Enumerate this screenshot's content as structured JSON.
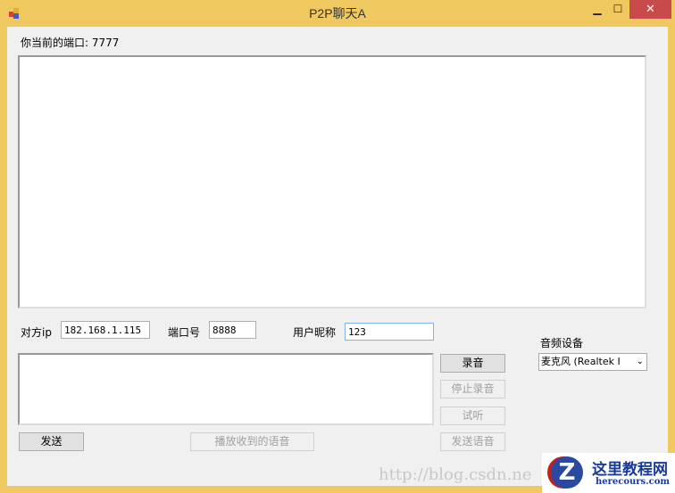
{
  "window": {
    "title": "P2P聊天A",
    "minimize": "▁",
    "maximize": "☐",
    "close": "✕"
  },
  "port_label": "你当前的端口: 7777",
  "chat_log": "",
  "peer_ip": {
    "label": "对方ip",
    "value": "182.168.1.115"
  },
  "peer_port": {
    "label": "端口号",
    "value": "8888"
  },
  "nickname": {
    "label": "用户昵称",
    "value": "123"
  },
  "message_input": "",
  "buttons": {
    "send": "发送",
    "play_received": "播放收到的语音",
    "record": "录音",
    "stop_record": "停止录音",
    "listen": "试听",
    "send_voice": "发送语音"
  },
  "audio_device": {
    "label": "音频设备",
    "selected": "麦克风 (Realtek I"
  },
  "watermark": {
    "url": "http://blog.csdn.ne",
    "logo_title": "这里教程网",
    "logo_sub": "herecours.com"
  }
}
